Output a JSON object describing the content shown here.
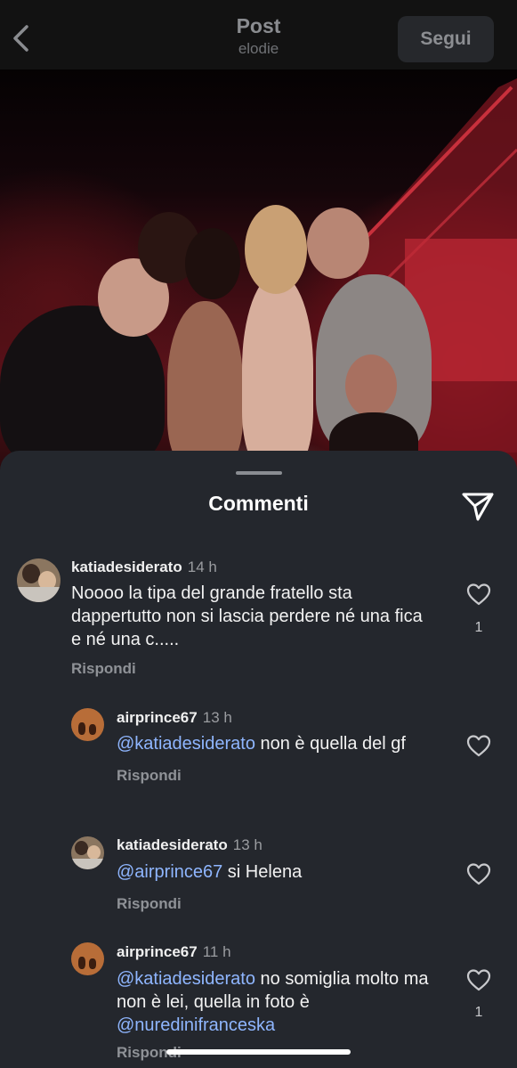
{
  "header": {
    "title": "Post",
    "subtitle": "elodie",
    "follow_label": "Segui"
  },
  "sheet": {
    "title": "Commenti"
  },
  "comments": [
    {
      "user": "katiadesiderato",
      "time": "14 h",
      "text": "Noooo la tipa  del grande fratello sta dappertutto non si lascia perdere né una fica e né una c.....",
      "reply_label": "Rispondi",
      "likes": "1"
    },
    {
      "user": "airprince67",
      "time": "13 h",
      "mention": "@katiadesiderato",
      "text": " non è quella del gf",
      "reply_label": "Rispondi"
    },
    {
      "user": "katiadesiderato",
      "time": "13 h",
      "mention": "@airprince67",
      "text": " si Helena",
      "reply_label": "Rispondi"
    },
    {
      "user": "airprince67",
      "time": "11 h",
      "mention": "@katiadesiderato",
      "text": " no somiglia molto ma non è lei, quella in foto è ",
      "mention2": "@nuredinifranceska",
      "reply_label": "Rispondi",
      "likes": "1"
    }
  ],
  "icons": {
    "back": "chevron-left-icon",
    "share": "paper-plane-icon",
    "like": "heart-outline-icon"
  },
  "colors": {
    "sheet_bg": "#24272d",
    "mention": "#8fb6ff",
    "topbar_bg": "#121212"
  }
}
